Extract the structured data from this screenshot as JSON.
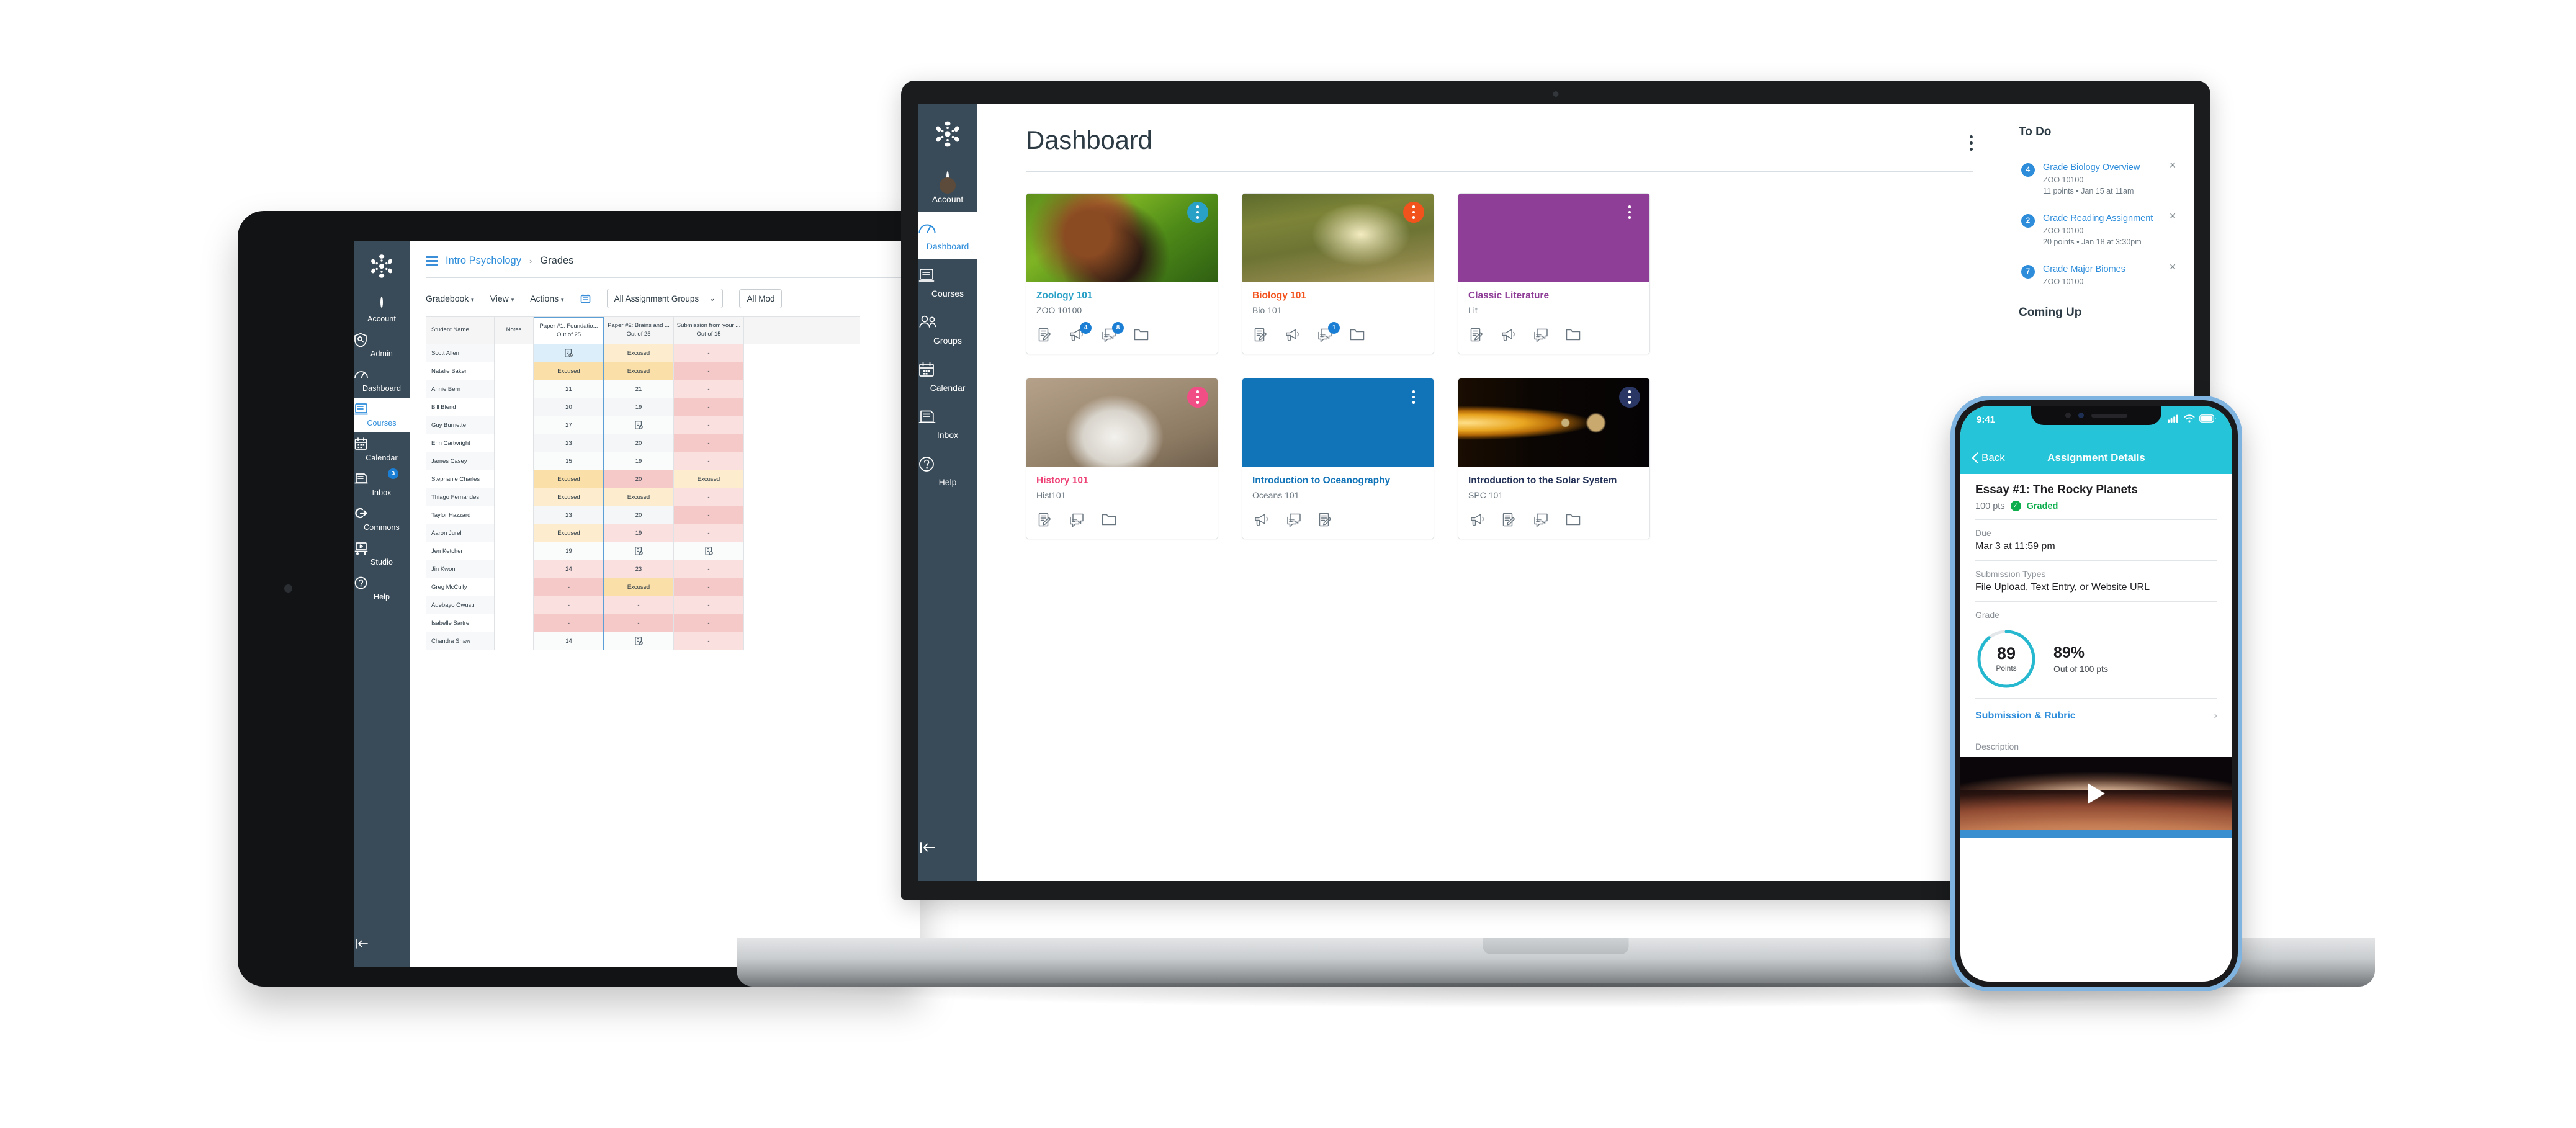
{
  "tablet": {
    "sidebar": {
      "logo_icon": "canvas-logo-icon",
      "items": [
        {
          "label": "Account",
          "icon": "avatar-icon",
          "active": false,
          "badge": null
        },
        {
          "label": "Admin",
          "icon": "shield-icon",
          "active": false,
          "badge": null
        },
        {
          "label": "Dashboard",
          "icon": "dashboard-icon",
          "active": false,
          "badge": null
        },
        {
          "label": "Courses",
          "icon": "book-icon",
          "active": true,
          "badge": null
        },
        {
          "label": "Calendar",
          "icon": "calendar-icon",
          "active": false,
          "badge": null
        },
        {
          "label": "Inbox",
          "icon": "inbox-icon",
          "active": false,
          "badge": "3"
        },
        {
          "label": "Commons",
          "icon": "commons-icon",
          "active": false,
          "badge": null
        },
        {
          "label": "Studio",
          "icon": "studio-icon",
          "active": false,
          "badge": null
        },
        {
          "label": "Help",
          "icon": "help-icon",
          "active": false,
          "badge": null
        }
      ],
      "collapse_icon": "collapse-arrow-icon"
    },
    "breadcrumb": {
      "menu_icon": "hamburger-icon",
      "course": "Intro Psychology",
      "separator": "›",
      "current": "Grades"
    },
    "toolbar": {
      "gradebook": "Gradebook",
      "view": "View",
      "actions": "Actions",
      "export_icon": "export-icon",
      "filter_groups": "All Assignment Groups",
      "filter_modules": "All Mod",
      "caret": "▾",
      "chevron": "⌄"
    },
    "gradebook": {
      "columns": [
        {
          "title": "Student Name",
          "sub": ""
        },
        {
          "title": "Notes",
          "sub": ""
        },
        {
          "title": "Paper #1: Foundatio...",
          "sub": "Out of 25",
          "selected": true
        },
        {
          "title": "Paper #2: Brains and ...",
          "sub": "Out of 25"
        },
        {
          "title": "Submission from your ...",
          "sub": "Out of 15"
        }
      ],
      "rows": [
        {
          "name": "Scott Allen",
          "c1": "doc",
          "c1bg": "#ddeefb",
          "c2": "Excused",
          "c2bg": "#fdeccd",
          "c3": "-",
          "c3bg": "#fbe0e0"
        },
        {
          "name": "Natalie Baker",
          "c1": "Excused",
          "c1bg": "#fbdfa8",
          "c2": "Excused",
          "c2bg": "#fbdfa8",
          "c3": "-",
          "c3bg": "#f6c9c9"
        },
        {
          "name": "Annie Bern",
          "c1": "21",
          "c1bg": "#fafbfb",
          "c2": "21",
          "c2bg": "#fafbfb",
          "c3": "-",
          "c3bg": "#fbe0e0"
        },
        {
          "name": "Bill Blend",
          "c1": "20",
          "c1bg": "#f4f6f7",
          "c2": "19",
          "c2bg": "#f4f6f7",
          "c3": "-",
          "c3bg": "#f6c9c9"
        },
        {
          "name": "Guy Burnette",
          "c1": "27",
          "c1bg": "#fafbfb",
          "c2": "doc",
          "c2bg": "#fafbfb",
          "c3": "-",
          "c3bg": "#fbe0e0"
        },
        {
          "name": "Erin Cartwright",
          "c1": "23",
          "c1bg": "#f4f6f7",
          "c2": "20",
          "c2bg": "#f4f6f7",
          "c3": "-",
          "c3bg": "#f6c9c9"
        },
        {
          "name": "James Casey",
          "c1": "15",
          "c1bg": "#fafbfb",
          "c2": "19",
          "c2bg": "#fafbfb",
          "c3": "-",
          "c3bg": "#fbe0e0"
        },
        {
          "name": "Stephanie Charles",
          "c1": "Excused",
          "c1bg": "#fbdfa8",
          "c2": "20",
          "c2bg": "#f6c9c9",
          "c3": "Excused",
          "c3bg": "#fdeccd"
        },
        {
          "name": "Thiago Fernandes",
          "c1": "Excused",
          "c1bg": "#fdeccd",
          "c2": "Excused",
          "c2bg": "#fdeccd",
          "c3": "-",
          "c3bg": "#fbe0e0"
        },
        {
          "name": "Taylor Hazzard",
          "c1": "23",
          "c1bg": "#f4f6f7",
          "c2": "20",
          "c2bg": "#f4f6f7",
          "c3": "-",
          "c3bg": "#f6c9c9"
        },
        {
          "name": "Aaron Jurel",
          "c1": "Excused",
          "c1bg": "#fdeccd",
          "c2": "19",
          "c2bg": "#fbe0e0",
          "c3": "-",
          "c3bg": "#fbe0e0"
        },
        {
          "name": "Jen Ketcher",
          "c1": "19",
          "c1bg": "#fafbfb",
          "c2": "doc",
          "c2bg": "#fafbfb",
          "c3": "doc",
          "c3bg": "#fafbfb"
        },
        {
          "name": "Jin Kwon",
          "c1": "24",
          "c1bg": "#fbe0e0",
          "c2": "23",
          "c2bg": "#fbe0e0",
          "c3": "-",
          "c3bg": "#fbe0e0"
        },
        {
          "name": "Greg McCully",
          "c1": "-",
          "c1bg": "#f6c9c9",
          "c2": "Excused",
          "c2bg": "#fbdfa8",
          "c3": "-",
          "c3bg": "#f6c9c9"
        },
        {
          "name": "Adebayo Owusu",
          "c1": "-",
          "c1bg": "#fbe0e0",
          "c2": "-",
          "c2bg": "#fbe0e0",
          "c3": "-",
          "c3bg": "#fbe0e0"
        },
        {
          "name": "Isabelle Sartre",
          "c1": "-",
          "c1bg": "#f6c9c9",
          "c2": "-",
          "c2bg": "#f6c9c9",
          "c3": "-",
          "c3bg": "#f6c9c9"
        },
        {
          "name": "Chandra Shaw",
          "c1": "14",
          "c1bg": "#fafbfb",
          "c2": "doc",
          "c2bg": "#fafbfb",
          "c3": "-",
          "c3bg": "#fbe0e0"
        }
      ]
    }
  },
  "laptop": {
    "sidebar": {
      "logo_icon": "canvas-logo-icon",
      "items": [
        {
          "label": "Account",
          "icon": "avatar-icon",
          "active": false
        },
        {
          "label": "Dashboard",
          "icon": "dashboard-icon",
          "active": true
        },
        {
          "label": "Courses",
          "icon": "book-icon",
          "active": false
        },
        {
          "label": "Groups",
          "icon": "groups-icon",
          "active": false
        },
        {
          "label": "Calendar",
          "icon": "calendar-icon",
          "active": false
        },
        {
          "label": "Inbox",
          "icon": "inbox-icon",
          "active": false
        },
        {
          "label": "Help",
          "icon": "help-icon",
          "active": false
        }
      ],
      "collapse_icon": "collapse-arrow-icon"
    },
    "header": {
      "title": "Dashboard",
      "options_icon": "kebab-menu-icon"
    },
    "cards": [
      {
        "name": "Zoology 101",
        "code": "ZOO 10100",
        "color": "#29A0C6",
        "menu_color": "#29A0C6",
        "hero": "red-panda-photo",
        "icons": [
          {
            "icon": "announcement-assignment-icon",
            "badge": null
          },
          {
            "icon": "megaphone-icon",
            "badge": "4"
          },
          {
            "icon": "discussion-icon",
            "badge": "8"
          },
          {
            "icon": "files-icon",
            "badge": null
          }
        ]
      },
      {
        "name": "Biology 101",
        "code": "Bio 101",
        "color": "#F2521B",
        "menu_color": "#F2521B",
        "hero": "forest-path-photo",
        "icons": [
          {
            "icon": "assignment-icon",
            "badge": null
          },
          {
            "icon": "megaphone-icon",
            "badge": null
          },
          {
            "icon": "discussion-icon",
            "badge": "1"
          },
          {
            "icon": "files-icon",
            "badge": null
          }
        ]
      },
      {
        "name": "Classic Literature",
        "code": "Lit",
        "color": "#8F3E97",
        "menu_color": "transparent",
        "hero": "solid-purple",
        "icons": [
          {
            "icon": "assignment-icon",
            "badge": null
          },
          {
            "icon": "megaphone-icon",
            "badge": null
          },
          {
            "icon": "discussion-icon",
            "badge": null
          },
          {
            "icon": "files-icon",
            "badge": null
          }
        ]
      },
      {
        "name": "History 101",
        "code": "Hist101",
        "color": "#EE4377",
        "menu_color": "#F24E86",
        "hero": "lincoln-memorial-photo",
        "icons": [
          {
            "icon": "assignment-icon",
            "badge": null
          },
          {
            "icon": "discussion-icon",
            "badge": null
          },
          {
            "icon": "files-icon",
            "badge": null
          }
        ]
      },
      {
        "name": "Introduction to Oceanography",
        "code": "Oceans 101",
        "color": "#1173B8",
        "menu_color": "transparent",
        "hero": "solid-blue",
        "icons": [
          {
            "icon": "megaphone-icon",
            "badge": null
          },
          {
            "icon": "discussion-icon",
            "badge": null
          },
          {
            "icon": "assignment-icon",
            "badge": null
          }
        ]
      },
      {
        "name": "Introduction to the Solar System",
        "code": "SPC 101",
        "color": "#253358",
        "menu_color": "#2A3663",
        "hero": "solar-system-photo",
        "icons": [
          {
            "icon": "megaphone-icon",
            "badge": null
          },
          {
            "icon": "assignment-icon",
            "badge": null
          },
          {
            "icon": "discussion-icon",
            "badge": null
          },
          {
            "icon": "files-icon",
            "badge": null
          }
        ]
      }
    ],
    "todo": {
      "heading": "To Do",
      "close_icon": "close-icon",
      "items": [
        {
          "count": "4",
          "title": "Grade Biology Overview",
          "course": "ZOO 10100",
          "meta": "11 points • Jan 15 at 11am"
        },
        {
          "count": "2",
          "title": "Grade Reading Assignment",
          "course": "ZOO 10100",
          "meta": "20 points • Jan 18 at 3:30pm"
        },
        {
          "count": "7",
          "title": "Grade Major Biomes",
          "course": "ZOO 10100",
          "meta": ""
        }
      ],
      "coming_up_heading": "Coming Up"
    }
  },
  "phone": {
    "status": {
      "time": "9:41",
      "signal_icon": "cellular-bars-icon",
      "wifi_icon": "wifi-icon",
      "battery_icon": "battery-icon"
    },
    "navbar": {
      "back_label": "Back",
      "back_icon": "chevron-left-icon",
      "title": "Assignment Details"
    },
    "assignment": {
      "title": "Essay #1: The Rocky Planets",
      "points": "100 pts",
      "status": "Graded",
      "status_icon": "check-circle-icon",
      "due_label": "Due",
      "due_value": "Mar 3 at 11:59 pm",
      "submission_label": "Submission Types",
      "submission_value": "File Upload, Text Entry, or Website URL",
      "grade_label": "Grade",
      "grade_points": "89",
      "grade_points_label": "Points",
      "grade_percent": "89%",
      "grade_outof": "Out of 100 pts",
      "rubric_link": "Submission & Rubric",
      "rubric_chevron": "›",
      "description_label": "Description",
      "video_icon": "play-icon",
      "video_thumb": "mars-surface-video"
    }
  }
}
